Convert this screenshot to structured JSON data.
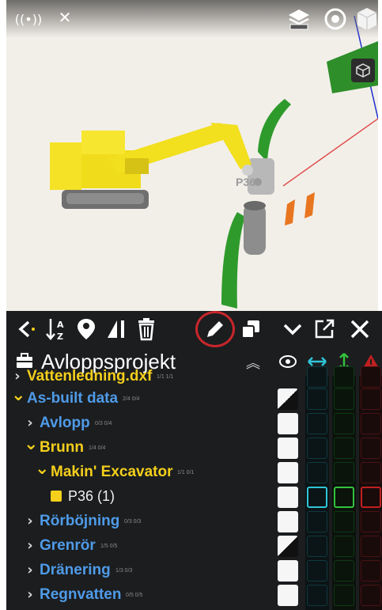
{
  "viewport": {
    "scene_label": "P36",
    "icons": [
      "gps-icon",
      "satellite-icon",
      "layers-icon",
      "target-icon",
      "cube-icon",
      "view-cube-icon"
    ]
  },
  "toolbar": {
    "buttons": [
      "back-icon",
      "sort-az-icon",
      "map-pin-icon",
      "measure-icon",
      "delete-icon",
      "edit-icon",
      "copy-icon",
      "select-check-icon",
      "external-link-icon",
      "close-icon"
    ]
  },
  "project": {
    "title": "Avloppsprojekt",
    "columns": [
      "visibility-eye-icon",
      "horizontal-tolerance-icon",
      "vertical-tolerance-icon",
      "warning-icon"
    ]
  },
  "tree": {
    "items": [
      {
        "label": "Vattenledning.dxf",
        "subtext": "1/1 1/1",
        "state": "collapsed",
        "color": "#f4cf1c"
      },
      {
        "label": "As-built data",
        "subtext": "2/4 0/4",
        "state": "expanded",
        "color": "#4f9be8"
      },
      {
        "label": "Avlopp",
        "subtext": "0/3 0/4",
        "state": "collapsed",
        "color": "#4f9be8"
      },
      {
        "label": "Brunn",
        "subtext": "1/4 0/4",
        "state": "expanded",
        "color": "#f4cf1c"
      },
      {
        "label": "Makin' Excavator",
        "subtext": "1/1 0/1",
        "state": "expanded",
        "color": "#f4cf1c"
      },
      {
        "label": "P36 (1)",
        "subtext": "",
        "state": "point",
        "color": "#f0f0f0"
      },
      {
        "label": "Rörböjning",
        "subtext": "0/3 0/3",
        "state": "collapsed",
        "color": "#4f9be8"
      },
      {
        "label": "Grenrör",
        "subtext": "1/5 0/5",
        "state": "collapsed",
        "color": "#4f9be8"
      },
      {
        "label": "Dränering",
        "subtext": "1/3 0/3",
        "state": "collapsed",
        "color": "#4f9be8"
      },
      {
        "label": "Regnvatten",
        "subtext": "0/5 0/5",
        "state": "collapsed",
        "color": "#4f9be8"
      }
    ]
  },
  "colors": {
    "accent_blue": "#4f9be8",
    "accent_yellow": "#f4cf1c",
    "tolerance_cyan": "#2fc4d8",
    "tolerance_green": "#34c23c",
    "warning_red": "#c02020",
    "panel_background": "#1b1d1f"
  }
}
